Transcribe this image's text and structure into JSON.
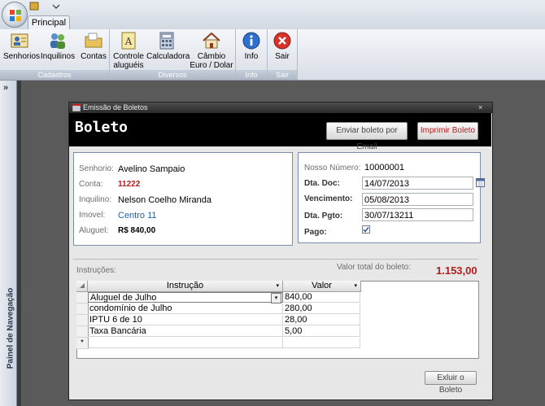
{
  "ribbon": {
    "tab": "Principal",
    "groups": [
      {
        "label": "Cadastros",
        "buttons": [
          {
            "label": "Senhorios",
            "icon": "users-card-icon"
          },
          {
            "label": "Inquilinos",
            "icon": "people-icon"
          },
          {
            "label": "Contas",
            "icon": "folder-icon"
          }
        ]
      },
      {
        "label": "Diversos",
        "buttons": [
          {
            "label": "Controle aluguéis",
            "icon": "document-a-icon"
          },
          {
            "label": "Calculadora",
            "icon": "calculator-icon"
          },
          {
            "label": "Câmbio Euro / Dolar",
            "icon": "house-icon"
          }
        ]
      },
      {
        "label": "Info",
        "buttons": [
          {
            "label": "Info",
            "icon": "info-icon"
          }
        ]
      },
      {
        "label": "Sair",
        "buttons": [
          {
            "label": "Sair",
            "icon": "close-circle-icon"
          }
        ]
      }
    ]
  },
  "nav": {
    "label": "Painel de Navegação",
    "toggle": "»"
  },
  "window": {
    "title": "Emissão de Boletos",
    "close": "×"
  },
  "header": {
    "title": "Boleto",
    "email_button": "Enviar boleto por Email",
    "print_button": "Imprimir Boleto"
  },
  "left_panel": {
    "senhorio_label": "Senhorio:",
    "senhorio": "Avelino Sampaio",
    "conta_label": "Conta:",
    "conta": "11222",
    "inquilino_label": "Inquilino:",
    "inquilino": "Nelson Coelho Miranda",
    "imovel_label": "Imovel:",
    "imovel": "Centro 11",
    "aluguel_label": "Aluguel:",
    "aluguel": "R$ 840,00"
  },
  "right_panel": {
    "nosso_numero_label": "Nosso Número:",
    "nosso_numero": "10000001",
    "dta_doc_label": "Dta. Doc:",
    "dta_doc": "14/07/2013",
    "vencimento_label": "Vencimento:",
    "vencimento": "05/08/2013",
    "dta_pgto_label": "Dta. Pgto:",
    "dta_pgto": "30/07/13211",
    "pago_label": "Pago:",
    "pago_checked": true
  },
  "instrucoes_label": "Instruções:",
  "valor_total_label": "Valor total  do boleto:",
  "valor_total": "1.153,00",
  "grid": {
    "col_instrucao": "Instrução",
    "col_valor": "Valor",
    "rows": [
      {
        "instrucao": "Aluguel de Julho",
        "valor": "840,00"
      },
      {
        "instrucao": "condomínio de Julho",
        "valor": "280,00"
      },
      {
        "instrucao": "IPTU 6 de 10",
        "valor": "28,00"
      },
      {
        "instrucao": "Taxa Bancária",
        "valor": "5,00"
      }
    ],
    "new_row_marker": "*"
  },
  "excluir_button": "Exluir o Boleto",
  "colors": {
    "accent_red": "#b31c1c",
    "link_blue": "#1f5fa8",
    "header_bg": "#000000"
  }
}
